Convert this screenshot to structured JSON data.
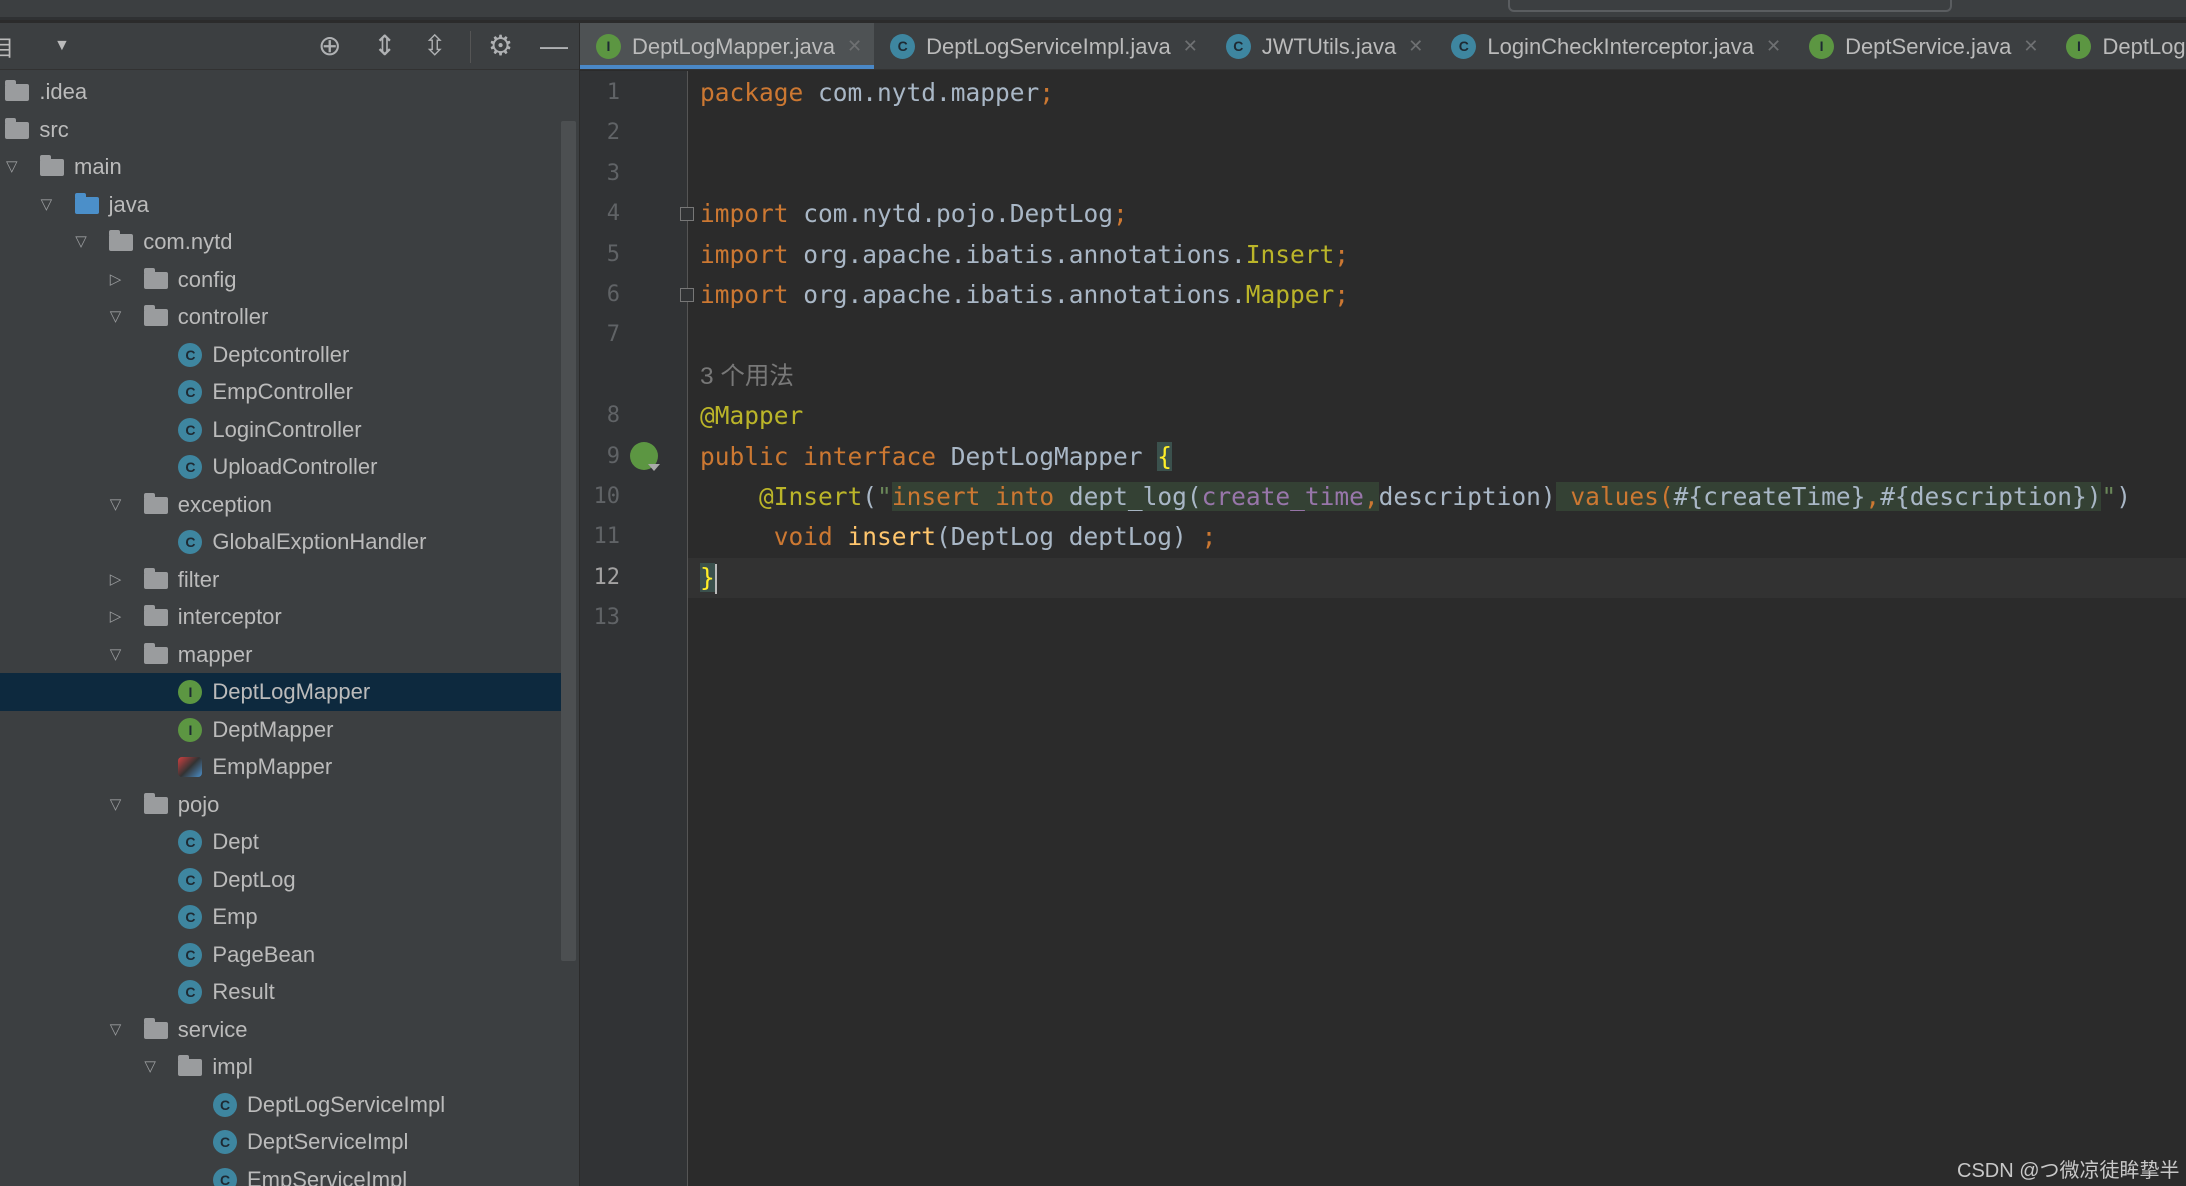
{
  "sidebar": {
    "title": "目",
    "toolbar_icons": [
      "locate-icon",
      "expand-all-icon",
      "collapse-all-icon",
      "gear-icon",
      "minimize-icon"
    ],
    "tree": [
      {
        "label": ".idea",
        "depth": -1,
        "type": "folder"
      },
      {
        "label": "src",
        "depth": -1,
        "type": "folder"
      },
      {
        "label": "main",
        "depth": 0,
        "type": "folder",
        "expanded": true
      },
      {
        "label": "java",
        "depth": 1,
        "type": "folder-blue",
        "expanded": true
      },
      {
        "label": "com.nytd",
        "depth": 2,
        "type": "folder",
        "expanded": true
      },
      {
        "label": "config",
        "depth": 3,
        "type": "folder",
        "expanded": false
      },
      {
        "label": "controller",
        "depth": 3,
        "type": "folder",
        "expanded": true
      },
      {
        "label": "Deptcontroller",
        "depth": 4,
        "type": "class"
      },
      {
        "label": "EmpController",
        "depth": 4,
        "type": "class"
      },
      {
        "label": "LoginController",
        "depth": 4,
        "type": "class"
      },
      {
        "label": "UploadController",
        "depth": 4,
        "type": "class"
      },
      {
        "label": "exception",
        "depth": 3,
        "type": "folder",
        "expanded": true
      },
      {
        "label": "GlobalExptionHandler",
        "depth": 4,
        "type": "class"
      },
      {
        "label": "filter",
        "depth": 3,
        "type": "folder",
        "expanded": false
      },
      {
        "label": "interceptor",
        "depth": 3,
        "type": "folder",
        "expanded": false
      },
      {
        "label": "mapper",
        "depth": 3,
        "type": "folder",
        "expanded": true
      },
      {
        "label": "DeptLogMapper",
        "depth": 4,
        "type": "interface",
        "selected": true
      },
      {
        "label": "DeptMapper",
        "depth": 4,
        "type": "interface"
      },
      {
        "label": "EmpMapper",
        "depth": 4,
        "type": "special"
      },
      {
        "label": "pojo",
        "depth": 3,
        "type": "folder",
        "expanded": true
      },
      {
        "label": "Dept",
        "depth": 4,
        "type": "class"
      },
      {
        "label": "DeptLog",
        "depth": 4,
        "type": "class"
      },
      {
        "label": "Emp",
        "depth": 4,
        "type": "class"
      },
      {
        "label": "PageBean",
        "depth": 4,
        "type": "class"
      },
      {
        "label": "Result",
        "depth": 4,
        "type": "class"
      },
      {
        "label": "service",
        "depth": 3,
        "type": "folder",
        "expanded": true
      },
      {
        "label": "impl",
        "depth": 4,
        "type": "folder",
        "expanded": true
      },
      {
        "label": "DeptLogServiceImpl",
        "depth": 5,
        "type": "class"
      },
      {
        "label": "DeptServiceImpl",
        "depth": 5,
        "type": "class"
      },
      {
        "label": "EmpServiceImpl",
        "depth": 5,
        "type": "class"
      }
    ]
  },
  "tabs": [
    {
      "label": "DeptLogMapper.java",
      "type": "interface",
      "active": true
    },
    {
      "label": "DeptLogServiceImpl.java",
      "type": "class"
    },
    {
      "label": "JWTUtils.java",
      "type": "class"
    },
    {
      "label": "LoginCheckInterceptor.java",
      "type": "class"
    },
    {
      "label": "DeptService.java",
      "type": "interface"
    },
    {
      "label": "DeptLogService.java",
      "type": "interface"
    }
  ],
  "editor": {
    "current_line": 12,
    "lines": [
      {
        "n": "1",
        "tokens": [
          [
            "package ",
            "kw"
          ],
          [
            "com.nytd.mapper",
            "plain"
          ],
          [
            ";",
            "kw"
          ]
        ]
      },
      {
        "n": "2",
        "tokens": []
      },
      {
        "n": "3",
        "tokens": []
      },
      {
        "n": "4",
        "fold": true,
        "tokens": [
          [
            "import ",
            "kw"
          ],
          [
            "com.nytd.pojo.DeptLog",
            "plain"
          ],
          [
            ";",
            "kw"
          ]
        ]
      },
      {
        "n": "5",
        "tokens": [
          [
            "import ",
            "kw"
          ],
          [
            "org.apache.ibatis.annotations.",
            "plain"
          ],
          [
            "Insert",
            "ann"
          ],
          [
            ";",
            "kw"
          ]
        ]
      },
      {
        "n": "6",
        "fold": true,
        "tokens": [
          [
            "import ",
            "kw"
          ],
          [
            "org.apache.ibatis.annotations.",
            "plain"
          ],
          [
            "Mapper",
            "ann"
          ],
          [
            ";",
            "kw"
          ]
        ]
      },
      {
        "n": "7",
        "tokens": []
      },
      {
        "n": "",
        "tokens": [
          [
            "3 个用法",
            "hint"
          ]
        ]
      },
      {
        "n": "8",
        "tokens": [
          [
            "@Mapper",
            "ann"
          ]
        ]
      },
      {
        "n": "9",
        "tokens": [
          [
            "public ",
            "kw"
          ],
          [
            "interface ",
            "kw"
          ],
          [
            "DeptLogMapper ",
            "plain"
          ],
          [
            "{",
            "brace"
          ]
        ]
      },
      {
        "n": "10",
        "tokens": [
          [
            "    ",
            "plain"
          ],
          [
            "@Insert",
            "ann"
          ],
          [
            "(",
            "plain"
          ],
          [
            "\"",
            "str"
          ],
          [
            "insert into ",
            "kw",
            "hl"
          ],
          [
            "dept_log(",
            "plain",
            "hl"
          ],
          [
            "create_time",
            "field",
            "hl"
          ],
          [
            ",",
            "kw",
            "hl"
          ],
          [
            "description)",
            "plain"
          ],
          [
            " values(",
            "kw",
            "hl"
          ],
          [
            "#{createTime}",
            "plain",
            "hl"
          ],
          [
            ",",
            "kw",
            "hl"
          ],
          [
            "#{description})",
            "plain",
            "hl"
          ],
          [
            "\"",
            "str"
          ],
          [
            ")",
            "plain"
          ]
        ]
      },
      {
        "n": "11",
        "tokens": [
          [
            "     ",
            "plain"
          ],
          [
            "void ",
            "kw"
          ],
          [
            "insert",
            "method"
          ],
          [
            "(DeptLog deptLog) ",
            "plain"
          ],
          [
            ";",
            "kw"
          ]
        ]
      },
      {
        "n": "12",
        "tokens": [
          [
            "}",
            "brace"
          ]
        ],
        "caret": true
      },
      {
        "n": "13",
        "tokens": []
      }
    ]
  },
  "watermark": "CSDN @つ微凉徒眸挚半",
  "colors": {
    "accent": "#4a88c7",
    "selection": "#0d293e",
    "keyword": "#cc7832",
    "annotation": "#bbb529"
  }
}
